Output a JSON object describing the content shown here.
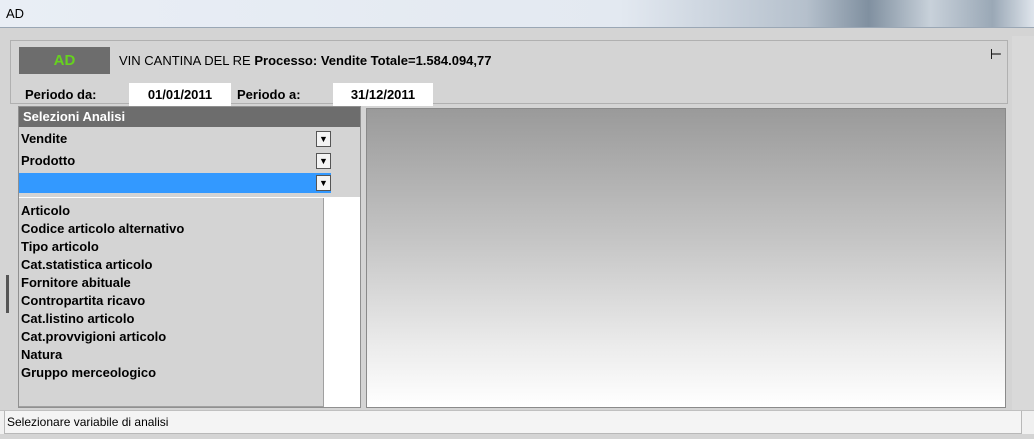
{
  "window": {
    "title": "AD"
  },
  "header": {
    "code": "AD",
    "company_name": "VIN CANTINA DEL RE",
    "process_text": "Processo: Vendite Totale=1.584.094,77",
    "period_from_label": "Periodo da:",
    "period_from_value": "01/01/2011",
    "period_to_label": "Periodo a:",
    "period_to_value": "31/12/2011"
  },
  "selections": {
    "title": "Selezioni Analisi",
    "combos": [
      {
        "value": "Vendite"
      },
      {
        "value": "Prodotto"
      },
      {
        "value": ""
      }
    ],
    "dropdown_items": [
      "Articolo",
      "Codice articolo alternativo",
      "Tipo articolo",
      "Cat.statistica articolo",
      "Fornitore abituale",
      "Contropartita ricavo",
      "Cat.listino articolo",
      "Cat.provvigioni articolo",
      "Natura",
      "Gruppo merceologico"
    ]
  },
  "icons": {
    "pin": "pin-icon",
    "dropdown_arrow": "chevron-down-icon"
  },
  "colors": {
    "accent_green": "#66d21e",
    "selection_blue": "#3399ff",
    "header_gray": "#6d6d6d"
  },
  "status": {
    "text": "Selezionare variabile di analisi"
  }
}
